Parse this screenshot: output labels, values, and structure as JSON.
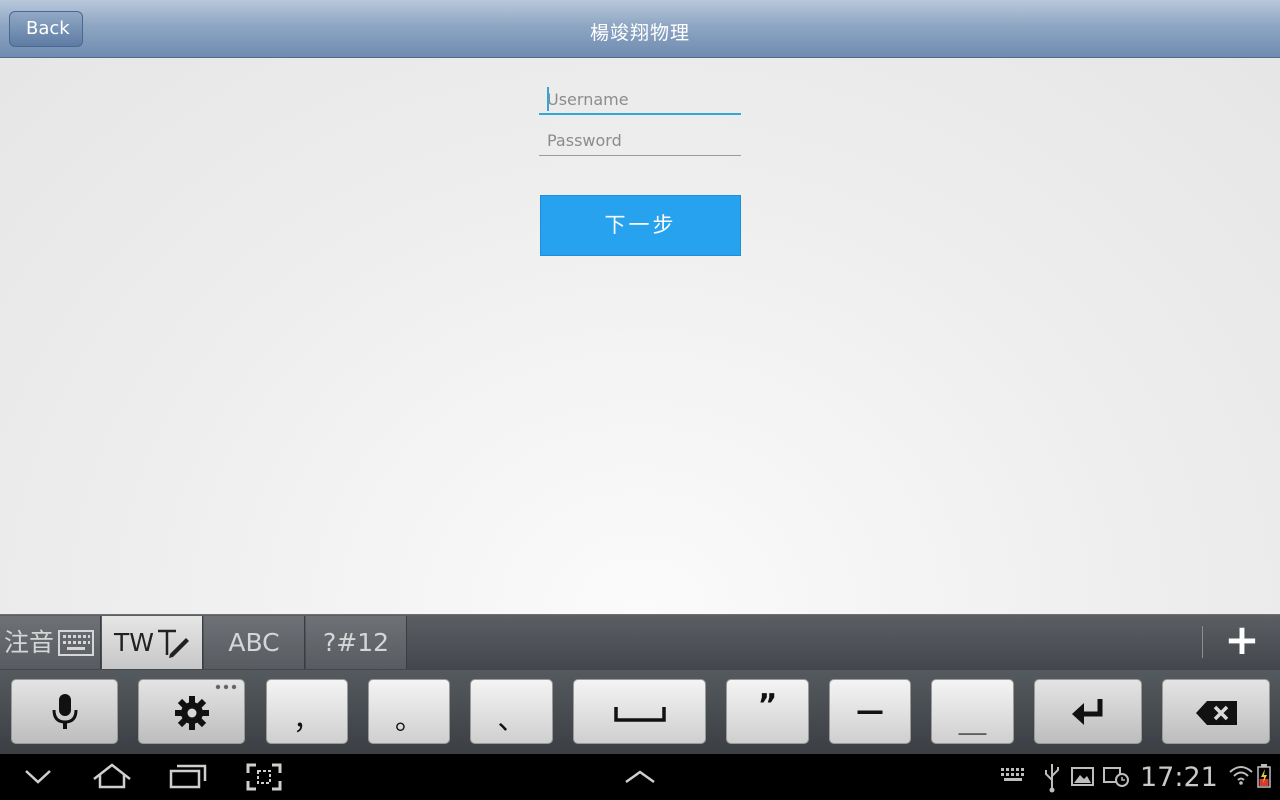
{
  "header": {
    "back_label": "Back",
    "title": "楊竣翔物理"
  },
  "form": {
    "username_placeholder": "Username",
    "password_placeholder": "Password",
    "next_label": "下一步"
  },
  "keyboard": {
    "modes": [
      {
        "label": "注音",
        "active": false
      },
      {
        "label": "TW",
        "active": true
      },
      {
        "label": "ABC",
        "active": false
      },
      {
        "label": "?#12",
        "active": false
      }
    ],
    "plus_label": "+",
    "keys": {
      "comma": "，",
      "period": "。",
      "enum_comma": "、",
      "quote": "”",
      "dash": "—",
      "underscore": "＿"
    }
  },
  "status_bar": {
    "time": "17:21"
  },
  "colors": {
    "accent": "#27a2ee",
    "title_bar": "#7f98b9",
    "focus_line": "#33a6d6"
  }
}
